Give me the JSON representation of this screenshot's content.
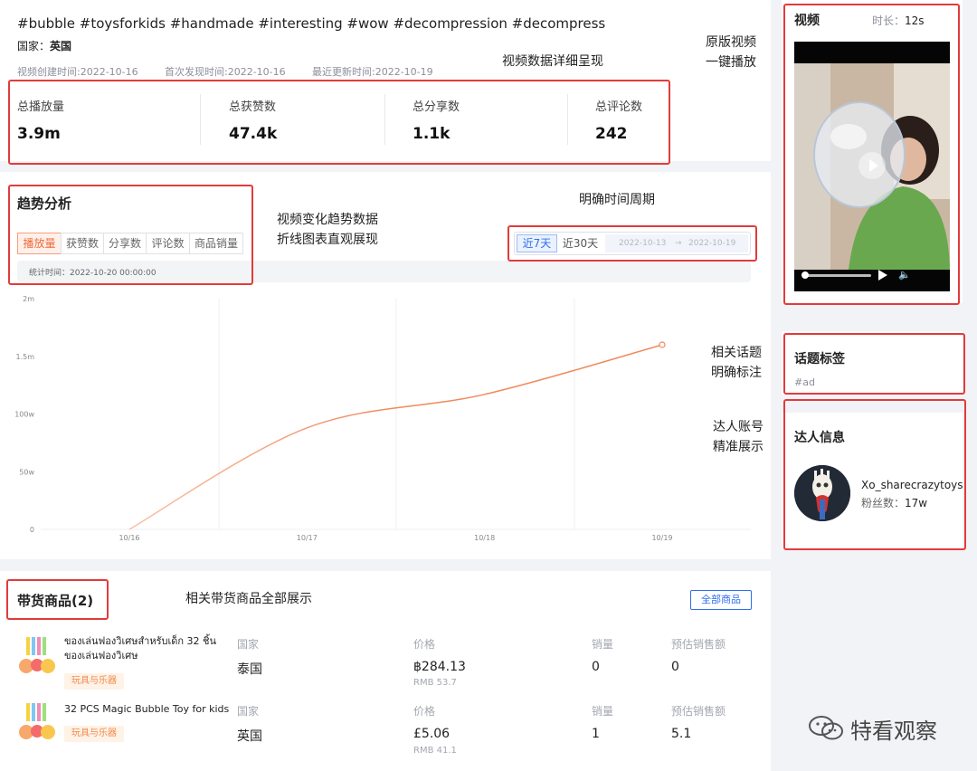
{
  "video_info": {
    "title": "#bubble #toysforkids #handmade #interesting #wow #decompression #decompress",
    "country_label": "国家：",
    "country_value": "英国",
    "created": "视频创建时间:2022-10-16",
    "first_seen": "首次发现时间:2022-10-16",
    "updated": "最近更新时间:2022-10-19"
  },
  "metrics": [
    {
      "label": "总播放量",
      "value": "3.9m"
    },
    {
      "label": "总获赞数",
      "value": "47.4k"
    },
    {
      "label": "总分享数",
      "value": "1.1k"
    },
    {
      "label": "总评论数",
      "value": "242"
    }
  ],
  "annotations": {
    "metrics": "视频数据详细呈现",
    "play_1": "原版视频",
    "play_2": "一键播放",
    "trend_1": "视频变化趋势数据",
    "trend_2": "折线图表直观展现",
    "period": "明确时间周期",
    "topic_1": "相关话题",
    "topic_2": "明确标注",
    "creator_1": "达人账号",
    "creator_2": "精准展示",
    "products": "相关带货商品全部展示"
  },
  "trend": {
    "title": "趋势分析",
    "tabs": [
      "播放量",
      "获赞数",
      "分享数",
      "评论数",
      "商品销量"
    ],
    "active_tab": "播放量",
    "stat_time": "统计时间：2022-10-20 00:00:00",
    "period_tabs": [
      "近7天",
      "近30天"
    ],
    "active_period": "近7天",
    "date_start": "2022-10-13",
    "date_arrow": "→",
    "date_end": "2022-10-19"
  },
  "chart_data": {
    "type": "line",
    "x": [
      "10/16",
      "10/17",
      "10/18",
      "10/19"
    ],
    "series": [
      {
        "values": [
          0,
          880000,
          1170000,
          1600000
        ]
      }
    ],
    "yticks": [
      "0",
      "50w",
      "100w",
      "1.5m",
      "2m"
    ],
    "ylim": [
      0,
      2000000
    ],
    "grid": "vertical",
    "color": "#f08a5d"
  },
  "video_panel": {
    "title": "视频",
    "duration_label": "时长：",
    "duration_value": "12s"
  },
  "topic_panel": {
    "title": "话题标签",
    "tag": "#ad"
  },
  "creator_panel": {
    "title": "达人信息",
    "name": "Xo_sharecrazytoys",
    "followers_label": "粉丝数：",
    "followers_value": "17w"
  },
  "products": {
    "title": "带货商品(2)",
    "all_button": "全部商品",
    "columns": [
      "国家",
      "价格",
      "销量",
      "预估销售额"
    ],
    "items": [
      {
        "name": "ของเล่นฟองวิเศษสำหรับเด็ก 32 ชิ้น ของเล่นฟองวิเศษ",
        "tag": "玩具与乐器",
        "country": "泰国",
        "price": "฿284.13",
        "rmb": "RMB 53.7",
        "sales": "0",
        "revenue": "0"
      },
      {
        "name": "32 PCS Magic Bubble Toy for kids",
        "tag": "玩具与乐器",
        "country": "英国",
        "price": "£5.06",
        "rmb": "RMB 41.1",
        "sales": "1",
        "revenue": "5.1"
      }
    ]
  },
  "watermark": "特看观察",
  "colors": {
    "accent": "#f06a3c",
    "annotation_border": "#e23b3b",
    "link": "#2f6fed"
  }
}
